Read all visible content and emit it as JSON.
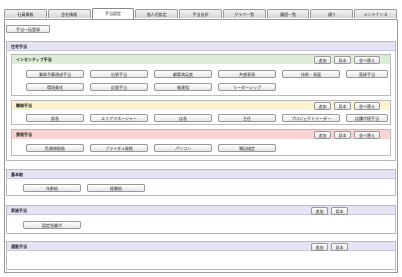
{
  "tabs": [
    {
      "label": "社員情報"
    },
    {
      "label": "会社情報"
    },
    {
      "label": "手当設定"
    },
    {
      "label": "個人別設定"
    },
    {
      "label": "手当自択"
    },
    {
      "label": "グラフ一覧"
    },
    {
      "label": "履歴一覧"
    },
    {
      "label": "通り"
    },
    {
      "label": "メンテナンス"
    }
  ],
  "top_button": "手当一括登録",
  "sections": {
    "allowance": {
      "title": "住宅手当",
      "subs": {
        "incentive": {
          "title": "インセンティブ手当",
          "actions": [
            "追加",
            "見本",
            "並べ替え"
          ],
          "items": [
            "業務予算達成手当",
            "出張手当",
            "顧客満足度",
            "共感表現",
            "技術・発展",
            "面接手当",
            "環境美化",
            "応援手当",
            "報連相",
            "リーダーシップ"
          ]
        },
        "position": {
          "title": "職務手当",
          "actions": [
            "追加",
            "見本",
            "並べ替え"
          ],
          "items": [
            "部長",
            "エリアマネージャー",
            "店長",
            "主任",
            "プロジェクトリーダー",
            "店舗代理手当"
          ]
        },
        "qualification": {
          "title": "資格手当",
          "actions": [
            "追加",
            "見本",
            "並べ替え"
          ],
          "items": [
            "危険物取扱",
            "ブライダル資格",
            "パソコン",
            "簿記検定"
          ]
        }
      }
    },
    "base": {
      "title": "基本給",
      "items": [
        "年齢給",
        "経験給"
      ]
    },
    "other": {
      "title": "家族手当",
      "actions": [
        "追加",
        "見本"
      ],
      "items": [
        "固定残業代"
      ]
    },
    "commute": {
      "title": "通勤手当",
      "actions": [
        "追加",
        "見本"
      ]
    }
  },
  "colors": {
    "incentive_head": "#dcefd6",
    "position_head": "#fbf3cf",
    "qualification_head": "#f8d3d3",
    "section_head": "#e4e4f4"
  }
}
